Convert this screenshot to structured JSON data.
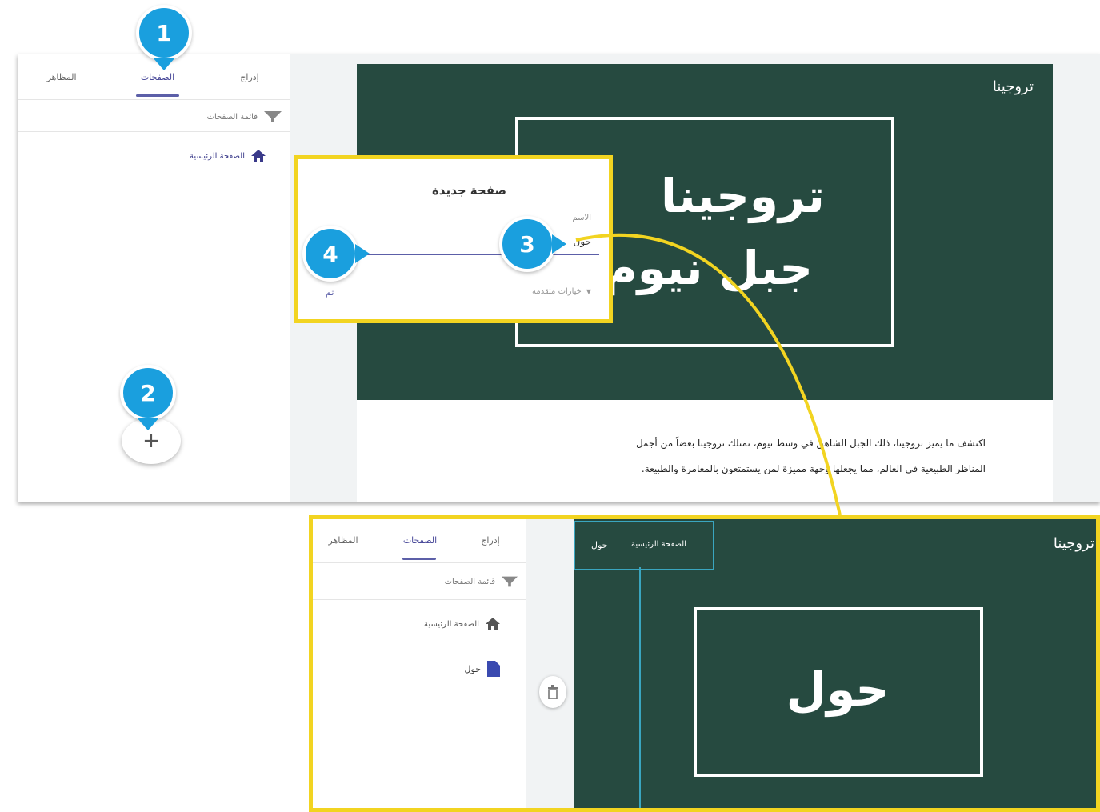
{
  "shot1": {
    "tabs": {
      "insert": "إدراج",
      "pages": "الصفحات",
      "themes": "المظاهر"
    },
    "pages_menu_label": "قائمة الصفحات",
    "home_page": "الصفحة الرئيسية",
    "fab_symbol": "+",
    "site_title": "تروجينا",
    "hero_line1": "تروجينا",
    "hero_line2": "جبل نيوم",
    "description_line1": "اكتشف ما يميز تروجينا، ذلك الجبل الشاهق في وسط نيوم، تمتلك تروجينا بعضاً من أجمل",
    "description_line2": "المناظر الطبيعية في العالم، مما يجعلها وجهة مميزة لمن يستمتعون بالمغامرة والطبيعة."
  },
  "dialog": {
    "title": "صفحة جديدة",
    "name_label": "الاسم",
    "name_value": "حول",
    "advanced_label": "خيارات متقدمة",
    "done_label": "تم"
  },
  "shot2": {
    "tabs": {
      "insert": "إدراج",
      "pages": "الصفحات",
      "themes": "المظاهر"
    },
    "pages_menu_label": "قائمة الصفحات",
    "home_page": "الصفحة الرئيسية",
    "about_page": "حول",
    "site_title": "تروجينا",
    "nav_home": "الصفحة الرئيسية",
    "nav_about": "حول",
    "hero_text": "حول"
  },
  "markers": {
    "m1": "1",
    "m2": "2",
    "m3": "3",
    "m4": "4"
  },
  "colors": {
    "marker": "#1a9fde",
    "highlight": "#f2d421",
    "canvas": "#264a40",
    "accent": "#5c5fa8"
  }
}
